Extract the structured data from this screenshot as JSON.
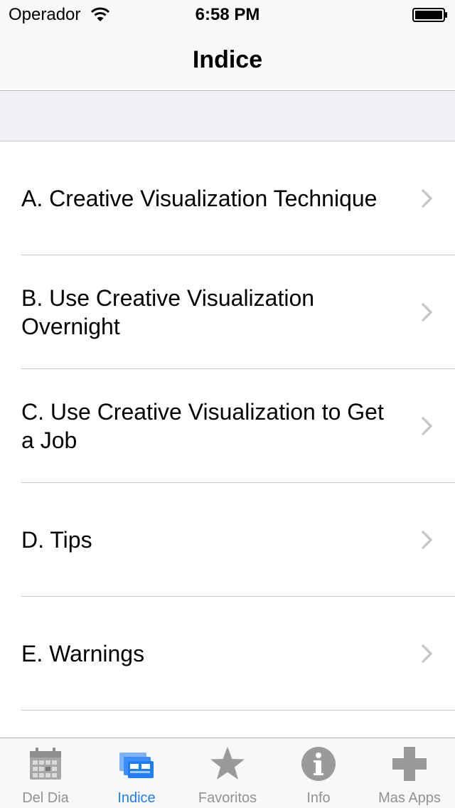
{
  "status_bar": {
    "carrier": "Operador",
    "time": "6:58 PM"
  },
  "nav": {
    "title": "Indice"
  },
  "list": {
    "items": [
      {
        "label": "A. Creative Visualization Technique"
      },
      {
        "label": "B. Use Creative Visualization Overnight"
      },
      {
        "label": "C. Use Creative Visualization to Get a Job"
      },
      {
        "label": "D. Tips"
      },
      {
        "label": "E. Warnings"
      }
    ]
  },
  "tab_bar": {
    "active_color": "#1f7ef6",
    "inactive_color": "#929292",
    "tabs": [
      {
        "label": "Del Dia",
        "icon": "calendar-icon",
        "active": false
      },
      {
        "label": "Indice",
        "icon": "index-cards-icon",
        "active": true
      },
      {
        "label": "Favoritos",
        "icon": "star-icon",
        "active": false
      },
      {
        "label": "Info",
        "icon": "info-icon",
        "active": false
      },
      {
        "label": "Mas Apps",
        "icon": "plus-icon",
        "active": false
      }
    ]
  }
}
